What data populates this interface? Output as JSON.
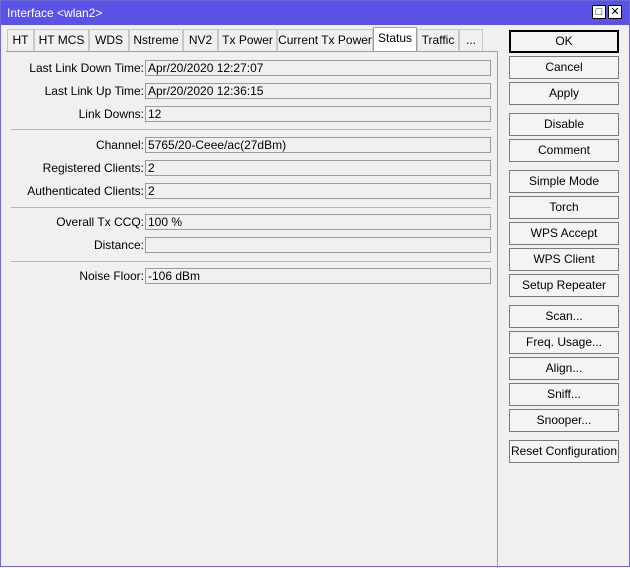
{
  "window": {
    "title": "Interface <wlan2>"
  },
  "tabs": [
    {
      "label": "HT"
    },
    {
      "label": "HT MCS"
    },
    {
      "label": "WDS"
    },
    {
      "label": "Nstreme"
    },
    {
      "label": "NV2"
    },
    {
      "label": "Tx Power"
    },
    {
      "label": "Current Tx Power"
    },
    {
      "label": "Status"
    },
    {
      "label": "Traffic"
    },
    {
      "label": "..."
    }
  ],
  "active_tab": "Status",
  "status": {
    "last_link_down_time": {
      "label": "Last Link Down Time:",
      "value": "Apr/20/2020 12:27:07"
    },
    "last_link_up_time": {
      "label": "Last Link Up Time:",
      "value": "Apr/20/2020 12:36:15"
    },
    "link_downs": {
      "label": "Link Downs:",
      "value": "12"
    },
    "channel": {
      "label": "Channel:",
      "value": "5765/20-Ceee/ac(27dBm)"
    },
    "registered_clients": {
      "label": "Registered Clients:",
      "value": "2"
    },
    "authenticated_clients": {
      "label": "Authenticated Clients:",
      "value": "2"
    },
    "overall_tx_ccq": {
      "label": "Overall Tx CCQ:",
      "value": "100 %"
    },
    "distance": {
      "label": "Distance:",
      "value": ""
    },
    "noise_floor": {
      "label": "Noise Floor:",
      "value": "-106 dBm"
    }
  },
  "buttons": {
    "ok": "OK",
    "cancel": "Cancel",
    "apply": "Apply",
    "disable": "Disable",
    "comment": "Comment",
    "simple_mode": "Simple Mode",
    "torch": "Torch",
    "wps_accept": "WPS Accept",
    "wps_client": "WPS Client",
    "setup_repeater": "Setup Repeater",
    "scan": "Scan...",
    "freq_usage": "Freq. Usage...",
    "align": "Align...",
    "sniff": "Sniff...",
    "snooper": "Snooper...",
    "reset_configuration": "Reset Configuration"
  }
}
